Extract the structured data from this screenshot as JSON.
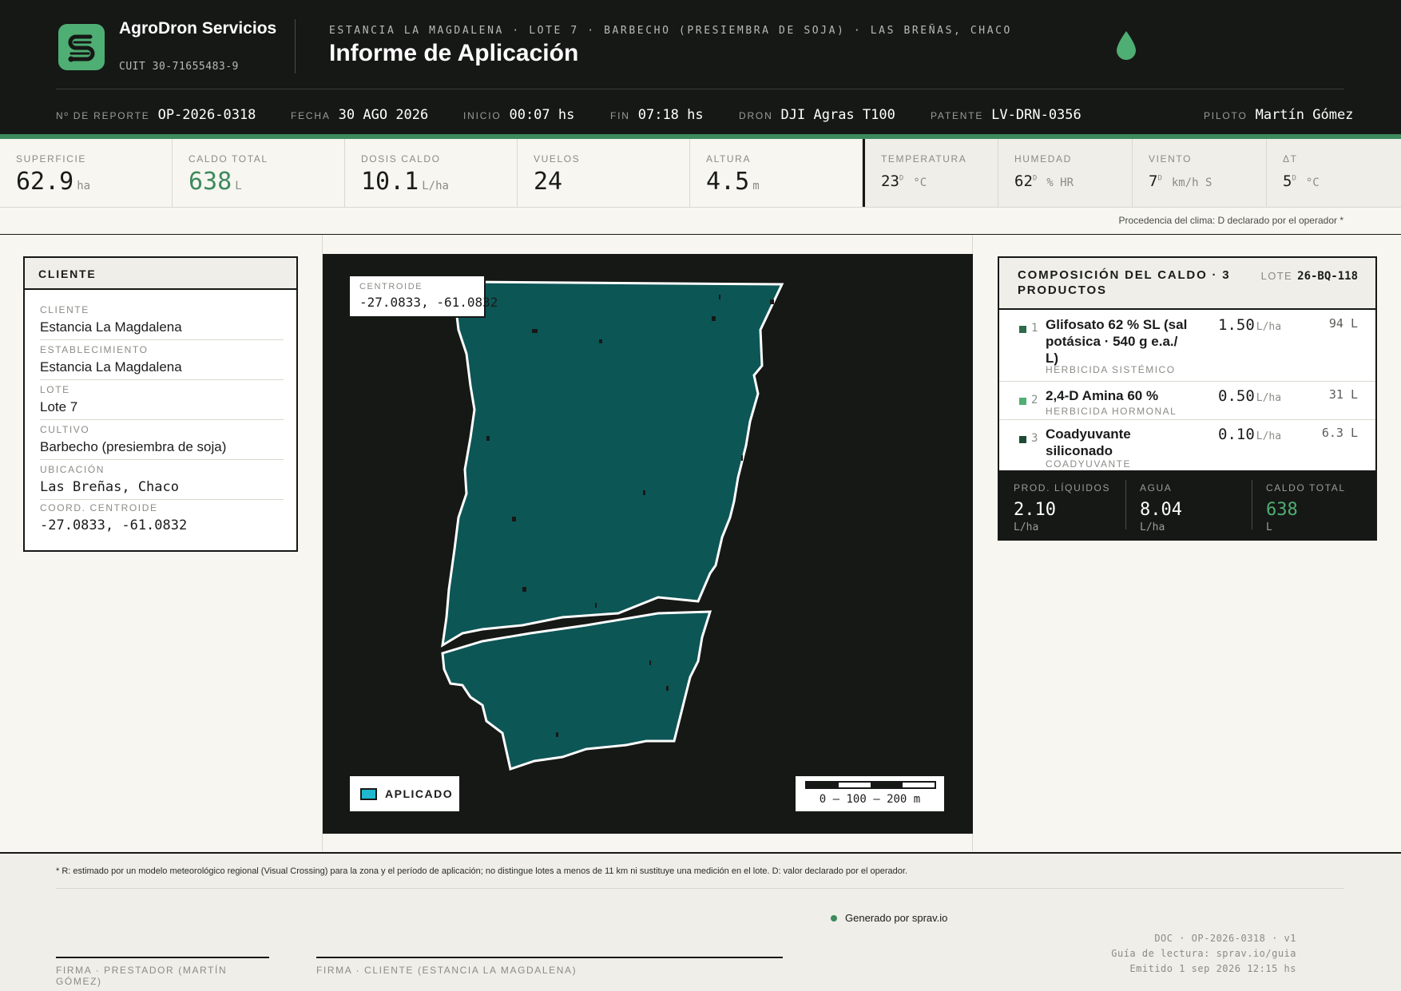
{
  "brand": {
    "name": "AgroDron Servicios",
    "cuit": "CUIT 30-71655483-9"
  },
  "header": {
    "breadcrumb": "ESTANCIA LA MAGDALENA · LOTE 7 · BARBECHO (PRESIEMBRA DE SOJA) · LAS BREÑAS, CHACO",
    "title": "Informe de Aplicación",
    "icon": "water-drop-icon"
  },
  "meta": {
    "report_label": "Nº DE REPORTE",
    "report": "OP-2026-0318",
    "fecha_label": "FECHA",
    "fecha": "30 AGO 2026",
    "inicio_label": "INICIO",
    "inicio": "00:07 hs",
    "fin_label": "FIN",
    "fin": "07:18 hs",
    "dron_label": "DRON",
    "dron": "DJI Agras T100",
    "patente_label": "PATENTE",
    "patente": "LV-DRN-0356",
    "piloto_label": "PILOTO",
    "piloto": "Martín Gómez"
  },
  "stats": {
    "superficie": {
      "label": "SUPERFICIE",
      "value": "62.9",
      "unit": "ha"
    },
    "caldo": {
      "label": "CALDO TOTAL",
      "value": "638",
      "unit": "L"
    },
    "dosis": {
      "label": "DOSIS CALDO",
      "value": "10.1",
      "unit": "L/ha"
    },
    "vuelos": {
      "label": "VUELOS",
      "value": "24"
    },
    "altura": {
      "label": "ALTURA",
      "value": "4.5",
      "unit": "m"
    },
    "temperatura": {
      "label": "TEMPERATURA",
      "value": "23",
      "src": "D",
      "unit": "°C"
    },
    "humedad": {
      "label": "HUMEDAD",
      "value": "62",
      "src": "D",
      "unit": "% HR"
    },
    "viento": {
      "label": "VIENTO",
      "value": "7",
      "src": "D",
      "unit": "km/h S"
    },
    "delta_t": {
      "label": "ΔT",
      "value": "5",
      "src": "D",
      "unit": "°C"
    }
  },
  "clima_note": "Procedencia del clima: D declarado por el operador *",
  "client": {
    "title": "CLIENTE",
    "rows": [
      {
        "label": "CLIENTE",
        "value": "Estancia La Magdalena"
      },
      {
        "label": "ESTABLECIMIENTO",
        "value": "Estancia La Magdalena"
      },
      {
        "label": "LOTE",
        "value": "Lote 7"
      },
      {
        "label": "CULTIVO",
        "value": "Barbecho (presiembra de soja)"
      },
      {
        "label": "UBICACIÓN",
        "value": "Las Breñas, Chaco"
      },
      {
        "label": "COORD. CENTROIDE",
        "value": "-27.0833, -61.0832"
      }
    ]
  },
  "map": {
    "centroid_label": "CENTROIDE",
    "centroid": "-27.0833, -61.0832",
    "legend": "APLICADO",
    "scale": "0 — 100 — 200 m",
    "colors": {
      "applied": "#0d5656",
      "legend_swatch": "#1fb8cf",
      "background": "#161816"
    }
  },
  "composition": {
    "title": "COMPOSICIÓN DEL CALDO · 3 PRODUCTOS",
    "lote_label": "LOTE",
    "lote": "26-BQ-118",
    "products": [
      {
        "n": "1",
        "name": "Glifosato 62 % SL (sal potásica · 540 g e.a./ L)",
        "type": "HERBICIDA SISTÉMICO",
        "dose": "1.50",
        "unit": "L/ha",
        "total": "94 L",
        "color": "#2e6b4a"
      },
      {
        "n": "2",
        "name": "2,4-D Amina 60 %",
        "type": "HERBICIDA HORMONAL",
        "dose": "0.50",
        "unit": "L/ha",
        "total": "31 L",
        "color": "#4fae73"
      },
      {
        "n": "3",
        "name": "Coadyuvante siliconado",
        "type": "COADYUVANTE",
        "dose": "0.10",
        "unit": "L/ha",
        "total": "6.3 L",
        "color": "#1e4a34"
      }
    ],
    "summary": [
      {
        "label": "PROD. LÍQUIDOS",
        "value": "2.10",
        "unit": "L/ha"
      },
      {
        "label": "AGUA",
        "value": "8.04",
        "unit": "L/ha"
      },
      {
        "label": "CALDO TOTAL",
        "value": "638",
        "unit": "L"
      }
    ]
  },
  "footer": {
    "note": "* R: estimado por un modelo meteorológico regional (Visual Crossing) para la zona y el período de aplicación; no distingue lotes a menos de 11 km ni sustituye una medición en el lote. D: valor declarado por el operador.",
    "generated": "Generado por sprav.io",
    "sig1": "FIRMA · PRESTADOR (MARTÍN GÓMEZ)",
    "sig2": "FIRMA · CLIENTE (ESTANCIA LA MAGDALENA)",
    "doc": "DOC · OP-2026-0318 · v1",
    "guide": "Guía de lectura: sprav.io/guia",
    "emitted": "Emitido 1 sep 2026 12:15 hs"
  }
}
